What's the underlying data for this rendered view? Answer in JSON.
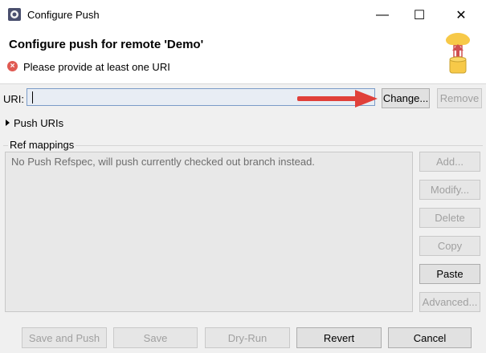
{
  "window": {
    "title": "Configure Push",
    "minimize": "—",
    "maximize": "☐",
    "close": "✕"
  },
  "header": {
    "title": "Configure push for remote 'Demo'",
    "error_message": "Please provide at least one URI",
    "error_icon": "error-icon"
  },
  "uri": {
    "label": "URI:",
    "value": "",
    "change_label": "Change...",
    "remove_label": "Remove"
  },
  "push_uris": {
    "label": "Push URIs"
  },
  "ref_mappings": {
    "label": "Ref mappings",
    "empty_text": "No Push Refspec, will push currently checked out branch instead.",
    "buttons": {
      "add": "Add...",
      "modify": "Modify...",
      "delete": "Delete",
      "copy": "Copy",
      "paste": "Paste",
      "advanced": "Advanced..."
    }
  },
  "footer": {
    "save_and_push": "Save and Push",
    "save": "Save",
    "dry_run": "Dry-Run",
    "revert": "Revert",
    "cancel": "Cancel"
  },
  "colors": {
    "annotation_arrow": "#e0403a",
    "error": "#e05a52",
    "cloud": "#f7c948"
  }
}
